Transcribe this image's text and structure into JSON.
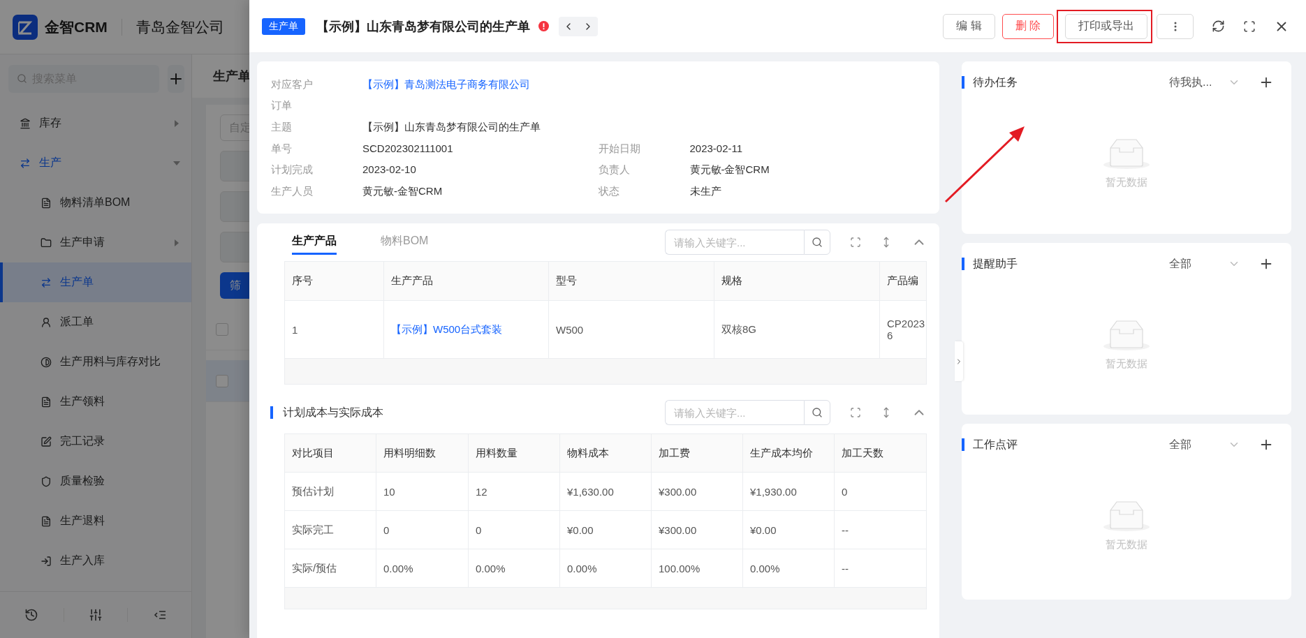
{
  "app": {
    "brand": "金智CRM",
    "company": "青岛金智公司",
    "menu_search": {
      "placeholder": "搜索菜单"
    },
    "menu": [
      {
        "label": "库存",
        "expanded": false,
        "selected": false
      },
      {
        "label": "生产",
        "expanded": true,
        "selected": false,
        "children": [
          {
            "label": "物料清单BOM",
            "selected": false
          },
          {
            "label": "生产申请",
            "expanded": false,
            "selected": false
          },
          {
            "label": "生产单",
            "selected": true
          },
          {
            "label": "派工单",
            "selected": false
          },
          {
            "label": "生产用料与库存对比",
            "selected": false
          },
          {
            "label": "生产领料",
            "selected": false
          },
          {
            "label": "完工记录",
            "selected": false
          },
          {
            "label": "质量检验",
            "selected": false
          },
          {
            "label": "生产退料",
            "selected": false
          },
          {
            "label": "生产入库",
            "selected": false
          }
        ]
      }
    ]
  },
  "page": {
    "title": "生产单",
    "filter": {
      "placeholder": "自定"
    },
    "filter_button": "筛",
    "rows": [
      {
        "checked": false,
        "selected": false
      },
      {
        "checked": false,
        "selected": true
      }
    ]
  },
  "drawer": {
    "tag": "生产单",
    "title": "【示例】山东青岛梦有限公司的生产单",
    "warning": true,
    "pointer_arrow": true,
    "actions": [
      {
        "label": "编 辑",
        "kind": "default",
        "annotated": false
      },
      {
        "label": "删 除",
        "kind": "danger",
        "annotated": false
      },
      {
        "label": "打印或导出",
        "kind": "default",
        "annotated": true
      }
    ],
    "info": [
      [
        {
          "label": "对应客户",
          "value": "【示例】青岛测法电子商务有限公司",
          "kind": "link"
        }
      ],
      [
        {
          "label": "订单"
        }
      ],
      [
        {
          "label": "主题",
          "value": "【示例】山东青岛梦有限公司的生产单"
        }
      ],
      [
        {
          "label": "单号",
          "value": "SCD202302111001"
        },
        {
          "label": "开始日期",
          "value": "2023-02-11"
        }
      ],
      [
        {
          "label": "计划完成",
          "value": "2023-02-10"
        },
        {
          "label": "负责人",
          "value": "黄元敏-金智CRM"
        }
      ],
      [
        {
          "label": "生产人员",
          "value": "黄元敏-金智CRM"
        },
        {
          "label": "状态",
          "value": "未生产"
        }
      ]
    ],
    "products": {
      "tabs": [
        {
          "label": "生产产品",
          "selected": true
        },
        {
          "label": "物料BOM",
          "selected": false
        }
      ],
      "search": {
        "placeholder": "请输入关键字..."
      },
      "columns": [
        {
          "label": "序号"
        },
        {
          "label": "生产产品",
          "kind": "link"
        },
        {
          "label": "型号"
        },
        {
          "label": "规格"
        },
        {
          "label": "产品编"
        }
      ],
      "rows": [
        [
          "1",
          "【示例】W500台式套装",
          "W500",
          "双核8G",
          "CP2023\n6"
        ]
      ]
    },
    "cost": {
      "title": "计划成本与实际成本",
      "search": {
        "placeholder": "请输入关键字..."
      },
      "columns": [
        {
          "label": "对比项目"
        },
        {
          "label": "用料明细数"
        },
        {
          "label": "用料数量"
        },
        {
          "label": "物料成本"
        },
        {
          "label": "加工费"
        },
        {
          "label": "生产成本均价"
        },
        {
          "label": "加工天数"
        }
      ],
      "rows": [
        [
          "预估计划",
          "10",
          "12",
          "¥1,630.00",
          "¥300.00",
          "¥1,930.00",
          "0"
        ],
        [
          "实际完工",
          "0",
          "0",
          "¥0.00",
          "¥300.00",
          "¥0.00",
          "--"
        ],
        [
          "实际/预估",
          "0.00%",
          "0.00%",
          "0.00%",
          "100.00%",
          "0.00%",
          "--"
        ]
      ]
    },
    "side": [
      {
        "title": "待办任务",
        "filter": "待我执...",
        "empty": "暂无数据"
      },
      {
        "title": "提醒助手",
        "filter": "全部",
        "empty": "暂无数据"
      },
      {
        "title": "工作点评",
        "filter": "全部",
        "empty": "暂无数据"
      }
    ]
  }
}
